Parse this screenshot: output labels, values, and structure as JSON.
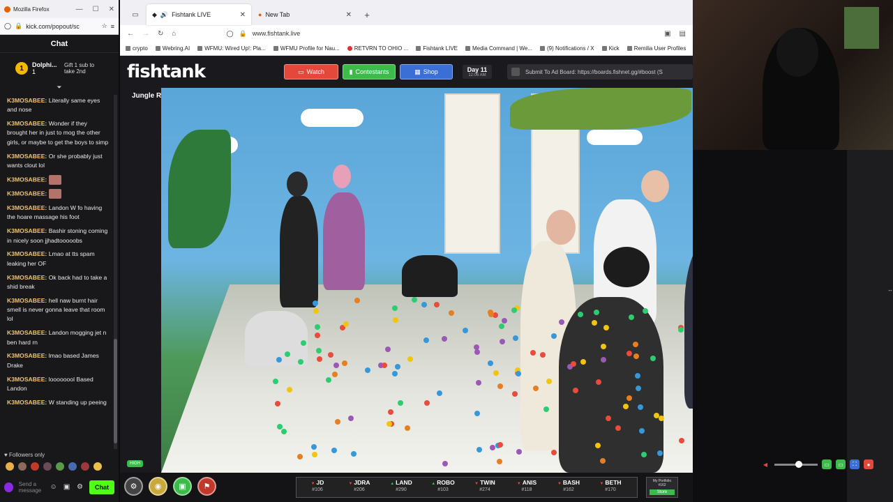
{
  "chat_window": {
    "title": "Mozilla Firefox",
    "url": "kick.com/popout/sc",
    "header": "Chat",
    "pinned": {
      "user": "Dolphi...",
      "count": "1",
      "rank": "1",
      "gift_text": "Gift 1 sub to take 2nd"
    },
    "messages": [
      {
        "user": "K3MOSABEE:",
        "text": "Literally same eyes and nose"
      },
      {
        "user": "K3MOSABEE:",
        "text": "Wonder if they brought her in just to mog the other girls, or maybe to get the boys to simp"
      },
      {
        "user": "K3MOSABEE:",
        "text": "Or she probably just wants clout lol"
      },
      {
        "user": "K3MOSABEE:",
        "text": "",
        "emote": true
      },
      {
        "user": "K3MOSABEE:",
        "text": "",
        "emote": true
      },
      {
        "user": "K3MOSABEE:",
        "text": "Landon W fo having the hoare massage his foot"
      },
      {
        "user": "K3MOSABEE:",
        "text": "Bashir stoning coming in nicely soon jjhadtooooobs"
      },
      {
        "user": "K3MOSABEE:",
        "text": "Lmao at tts spam leaking her OF"
      },
      {
        "user": "K3MOSABEE:",
        "text": "Ok back had to take a shid break"
      },
      {
        "user": "K3MOSABEE:",
        "text": "hell naw burnt hair smell is never gonna leave that room lol"
      },
      {
        "user": "K3MOSABEE:",
        "text": "Landon mogging jet n ben hard rn"
      },
      {
        "user": "K3MOSABEE:",
        "text": "lmao based James Drake"
      },
      {
        "user": "K3MOSABEE:",
        "text": "loooooool Based Landon"
      },
      {
        "user": "K3MOSABEE:",
        "text": "W standing up peeing"
      }
    ],
    "followers_only": "Followers only",
    "send_placeholder": "Send a message",
    "chat_button": "Chat"
  },
  "main_window": {
    "tabs": [
      {
        "label": "Fishtank LIVE",
        "active": true
      },
      {
        "label": "New Tab",
        "active": false
      }
    ],
    "address": "www.fishtank.live",
    "bookmarks": [
      "crypto",
      "Webring.AI",
      "WFMU: Wired Up!: Pla...",
      "WFMU Profile for Nau...",
      "RETVRN TO OHIO ...",
      "Fishtank LIVE",
      "Media Command | We...",
      "(9) Notifications / X",
      "Kick",
      "Remilia User Profiles"
    ]
  },
  "site": {
    "logo": "fishtank",
    "nav": {
      "watch": "Watch",
      "contestants": "Contestants",
      "shop": "Shop"
    },
    "day": "Day 11",
    "time": "12:06 AM",
    "adboard": "Submit To Ad Board: https://boards.fishnet.gg/#boost (S",
    "room": "Jungle Room",
    "quality": "HIGH",
    "scores": [
      {
        "name": "JD",
        "value": "#106",
        "dir": "down"
      },
      {
        "name": "JDRA",
        "value": "#206",
        "dir": "down"
      },
      {
        "name": "LAND",
        "value": "#290",
        "dir": "up"
      },
      {
        "name": "ROBO",
        "value": "#103",
        "dir": "up"
      },
      {
        "name": "TWIN",
        "value": "#274",
        "dir": "down"
      },
      {
        "name": "ANIS",
        "value": "#118",
        "dir": "down"
      },
      {
        "name": "BASH",
        "value": "#162",
        "dir": "down"
      },
      {
        "name": "BETH",
        "value": "#170",
        "dir": "down"
      }
    ],
    "portfolio": {
      "label": "My Portfolio",
      "value": "#162",
      "button": "Store"
    }
  }
}
